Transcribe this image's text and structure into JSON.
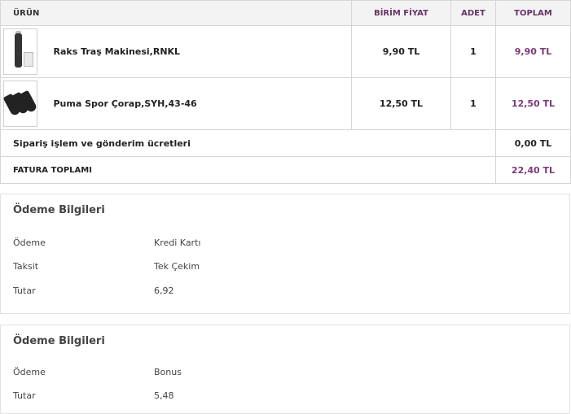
{
  "cart": {
    "headers": {
      "product": "ÜRÜN",
      "unit_price": "BİRİM FİYAT",
      "qty": "ADET",
      "total": "TOPLAM"
    },
    "items": [
      {
        "name": "Raks Traş Makinesi,RNKL",
        "unit_price": "9,90 TL",
        "qty": "1",
        "total": "9,90 TL",
        "icon": "razor-icon"
      },
      {
        "name": "Puma Spor Çorap,SYH,43-46",
        "unit_price": "12,50 TL",
        "qty": "1",
        "total": "12,50 TL",
        "icon": "socks-icon"
      }
    ],
    "fees": {
      "label": "Sipariş işlem ve gönderim ücretleri",
      "value": "0,00 TL"
    },
    "invoice": {
      "label": "FATURA TOPLAMI",
      "value": "22,40 TL"
    }
  },
  "payments": [
    {
      "title": "Ödeme Bilgileri",
      "rows": [
        {
          "label": "Ödeme",
          "value": "Kredi Kartı"
        },
        {
          "label": "Taksit",
          "value": "Tek Çekim"
        },
        {
          "label": "Tutar",
          "value": "6,92"
        }
      ]
    },
    {
      "title": "Ödeme Bilgileri",
      "rows": [
        {
          "label": "Ödeme",
          "value": "Bonus"
        },
        {
          "label": "Tutar",
          "value": "5,48"
        }
      ]
    }
  ],
  "colors": {
    "accent": "#663366",
    "price_total": "#7a3a7a",
    "header_bg": "#f3f3f3",
    "border": "#d6d6d6"
  }
}
